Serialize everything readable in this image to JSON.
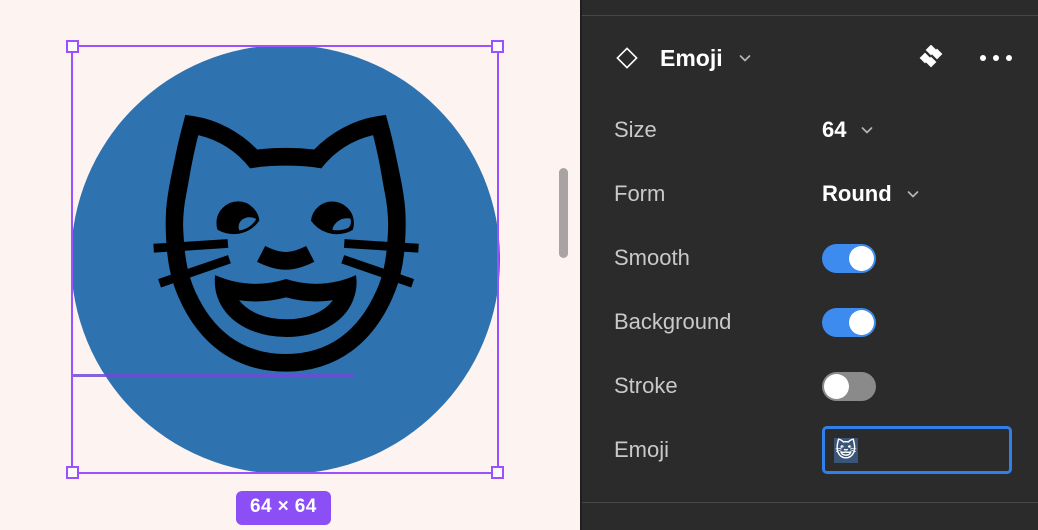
{
  "canvas": {
    "background_color": "#fdf3f0",
    "artboard": {
      "shape": "circle",
      "fill_color": "#2e72b0",
      "emoji": "😺"
    },
    "selection": {
      "stroke_color": "#9b51ff",
      "handle_names": [
        "top-left",
        "top-right",
        "bottom-left",
        "bottom-right"
      ]
    },
    "size_badge": {
      "label": "64 × 64",
      "background_color": "#8c4ef5"
    },
    "scrollbar": {
      "name": "vertical-scrollbar"
    }
  },
  "panel": {
    "background_color": "#2b2b2b",
    "header": {
      "icon": "diamond-icon",
      "title": "Emoji",
      "chevron": "chevron-down-icon",
      "actions": [
        {
          "name": "diamonds-icon",
          "label": "components"
        },
        {
          "name": "more-icon",
          "label": "..."
        }
      ]
    },
    "rows": [
      {
        "name": "size",
        "label": "Size",
        "type": "dropdown",
        "value": "64"
      },
      {
        "name": "form",
        "label": "Form",
        "type": "dropdown",
        "value": "Round"
      },
      {
        "name": "smooth",
        "label": "Smooth",
        "type": "toggle",
        "value": "on"
      },
      {
        "name": "background",
        "label": "Background",
        "type": "toggle",
        "value": "on"
      },
      {
        "name": "stroke",
        "label": "Stroke",
        "type": "toggle",
        "value": "off"
      },
      {
        "name": "emoji",
        "label": "Emoji",
        "type": "input",
        "value": "😺"
      }
    ],
    "colors": {
      "toggle_on": "#3d8bef",
      "toggle_off": "#8a8a8a",
      "focus_border": "#2f80ed"
    }
  }
}
